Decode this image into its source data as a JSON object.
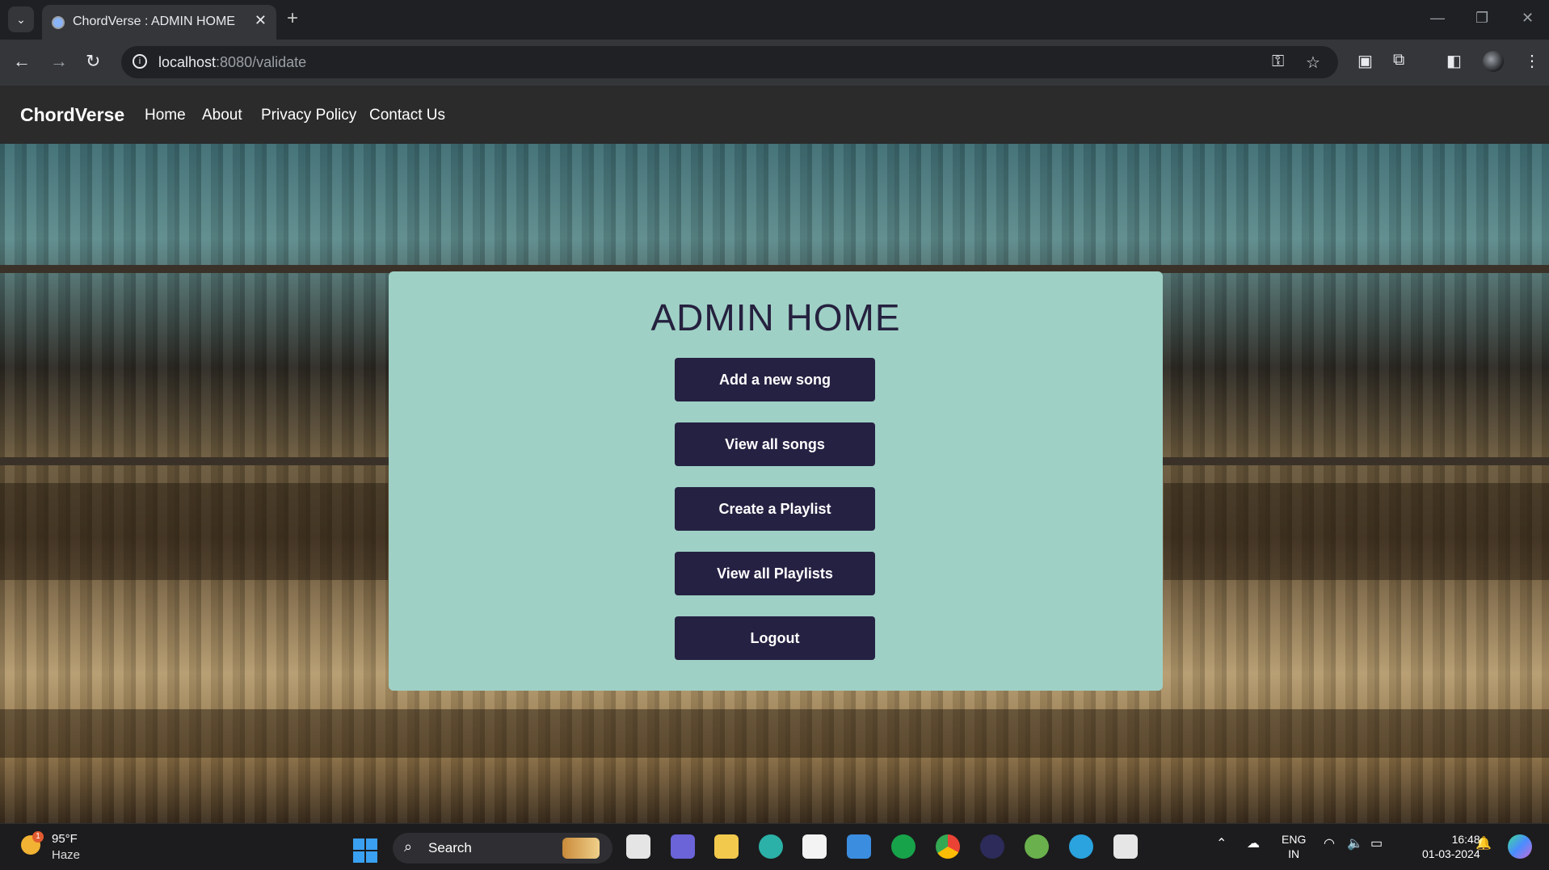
{
  "browser": {
    "tab_title": "ChordVerse : ADMIN HOME",
    "tab_close": "✕",
    "new_tab": "+",
    "url_host": "localhost",
    "url_rest": ":8080/validate",
    "icons": [
      "back-arrow-icon",
      "forward-arrow-icon",
      "reload-icon",
      "site-info-icon",
      "key-icon",
      "bookmark-star-icon",
      "extension-icon",
      "puzzle-icon",
      "side-panel-icon",
      "profile-avatar",
      "more-menu-icon"
    ]
  },
  "site_nav": {
    "brand": "ChordVerse",
    "links": [
      "Home",
      "About",
      "Privacy Policy",
      "Contact Us"
    ]
  },
  "admin": {
    "title": "ADMIN HOME",
    "buttons": [
      "Add a new song",
      "View all songs",
      "Create a Playlist",
      "View all Playlists",
      "Logout"
    ],
    "button_bg": "#252142",
    "card_bg": "#9fd0c5"
  },
  "taskbar": {
    "weather_temp": "95°F",
    "weather_desc": "Haze",
    "weather_badge": "1",
    "search_label": "Search",
    "lang_1": "ENG",
    "lang_2": "IN",
    "time": "16:48",
    "date": "01-03-2024"
  }
}
